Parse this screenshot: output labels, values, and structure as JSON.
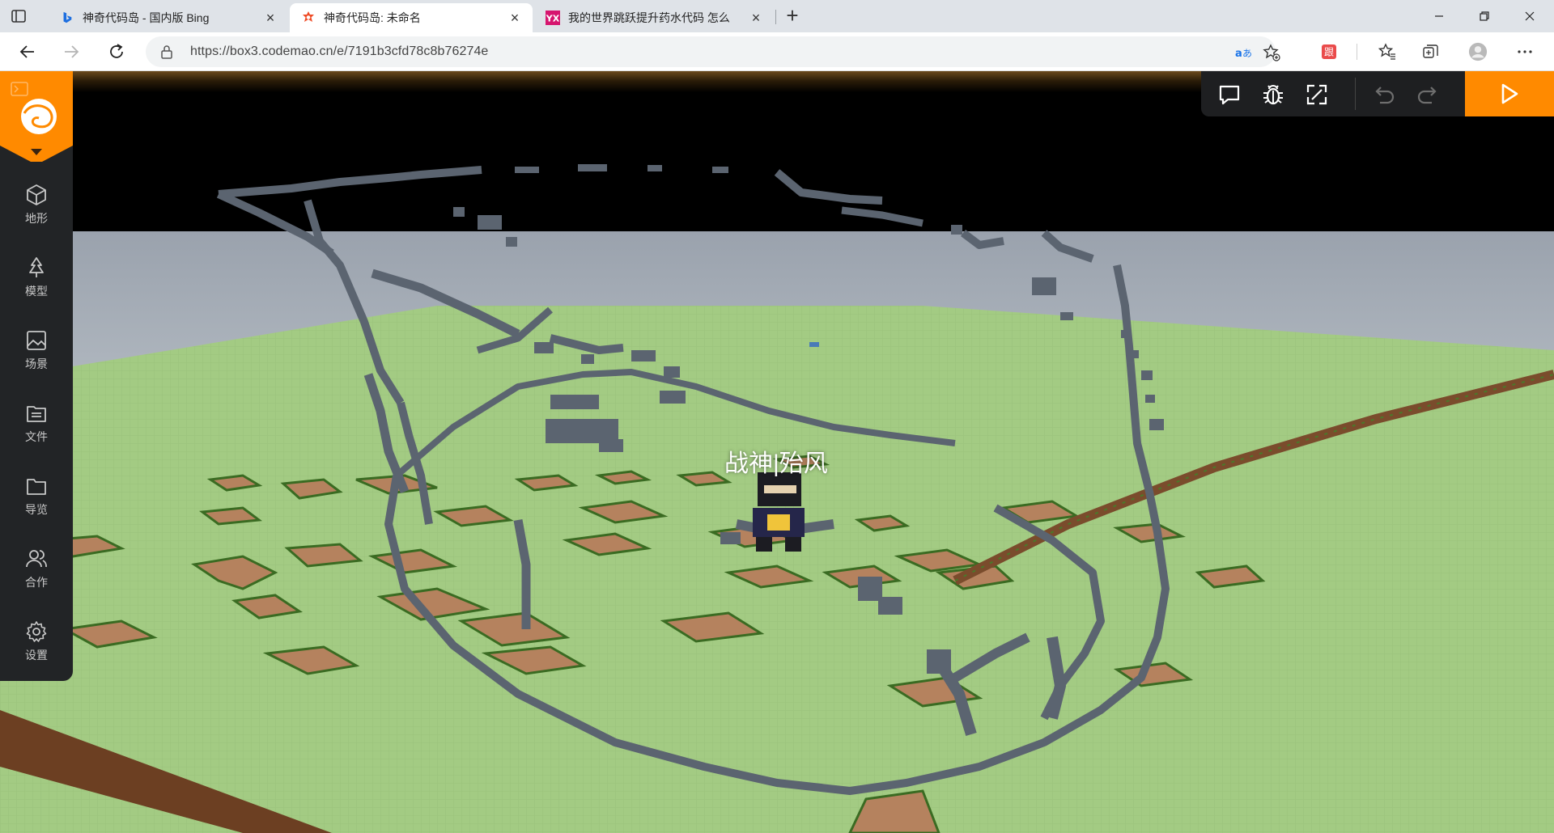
{
  "browser": {
    "tabs": [
      {
        "title": "神奇代码岛 - 国内版 Bing",
        "active": false,
        "favicon": "bing-icon"
      },
      {
        "title": "神奇代码岛: 未命名",
        "active": true,
        "favicon": "codemao-icon"
      },
      {
        "title": "我的世界跳跃提升药水代码 怎么",
        "active": false,
        "favicon": "yx-icon"
      }
    ],
    "newtab_label": "+",
    "close_glyph": "×",
    "url": "https://box3.codemao.cn/e/7191b3cfd78c8b76274e",
    "colors": {
      "accent": "#ff8a00",
      "tabstrip": "#dfe3e8"
    }
  },
  "editor": {
    "sidebar": [
      {
        "label": "地形",
        "icon": "cube-icon"
      },
      {
        "label": "模型",
        "icon": "tree-icon"
      },
      {
        "label": "场景",
        "icon": "image-icon"
      },
      {
        "label": "文件",
        "icon": "file-icon"
      },
      {
        "label": "导览",
        "icon": "folder-icon"
      },
      {
        "label": "合作",
        "icon": "users-icon"
      },
      {
        "label": "设置",
        "icon": "gear-icon"
      }
    ],
    "toolbar_icons": [
      "chat-icon",
      "debug-bug-icon",
      "fullscreen-icon",
      "undo-icon",
      "redo-icon"
    ],
    "play_icon": "play-icon",
    "player_name": "战神|殆风"
  }
}
